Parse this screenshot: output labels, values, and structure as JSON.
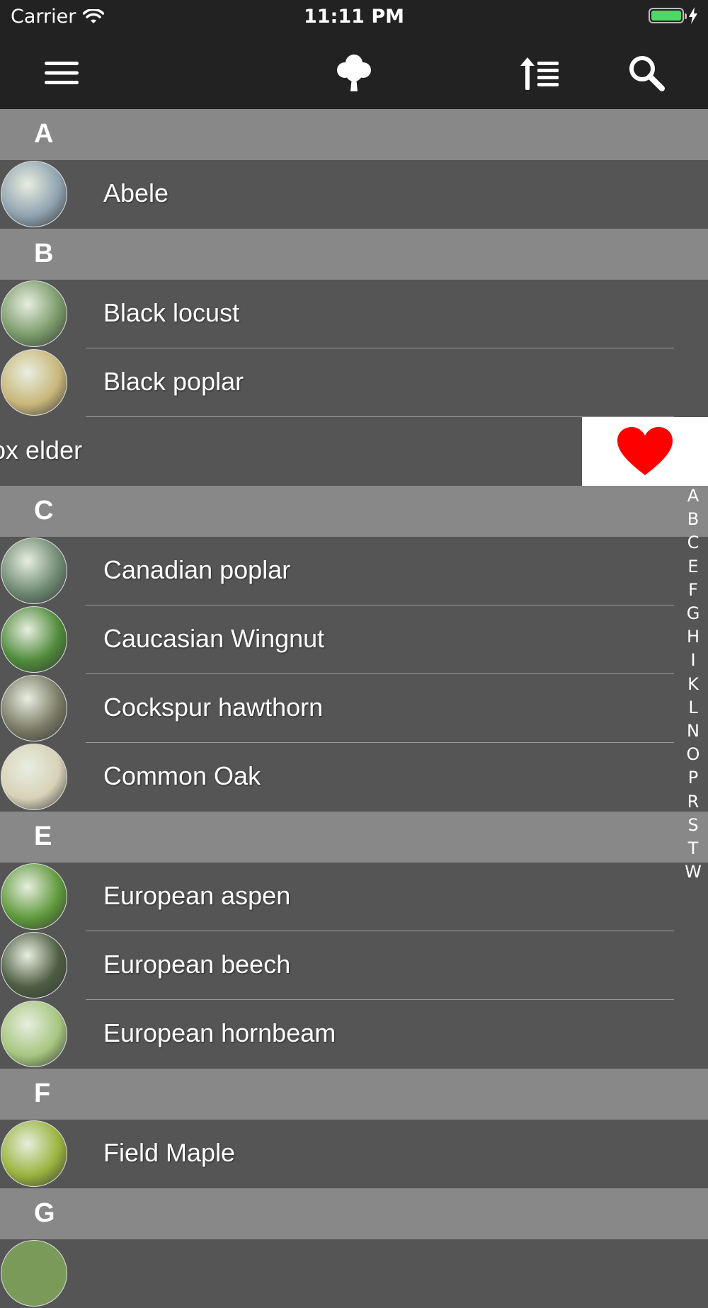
{
  "status_bar": {
    "carrier": "Carrier",
    "time": "11:11 PM"
  },
  "navbar": {
    "icons": [
      "menu-icon",
      "tree-icon",
      "sort-icon",
      "search-icon"
    ]
  },
  "sections": [
    {
      "letter": "A",
      "items": [
        {
          "name": "Abele",
          "thumb_color": "#8fa3b0"
        }
      ]
    },
    {
      "letter": "B",
      "items": [
        {
          "name": "Black locust",
          "thumb_color": "#7a9a6a"
        },
        {
          "name": "Black poplar",
          "thumb_color": "#c9b77a"
        },
        {
          "name": "ox elder",
          "thumb_color": "#555555"
        }
      ]
    },
    {
      "letter": "C",
      "items": [
        {
          "name": "Canadian poplar",
          "thumb_color": "#6e8a72"
        },
        {
          "name": "Caucasian Wingnut",
          "thumb_color": "#4f8a3a"
        },
        {
          "name": "Cockspur hawthorn",
          "thumb_color": "#7a7a66"
        },
        {
          "name": "Common Oak",
          "thumb_color": "#d8d2b8"
        }
      ]
    },
    {
      "letter": "E",
      "items": [
        {
          "name": "European aspen",
          "thumb_color": "#5f9a3c"
        },
        {
          "name": "European beech",
          "thumb_color": "#4e5e44"
        },
        {
          "name": "European hornbeam",
          "thumb_color": "#a7c680"
        }
      ]
    },
    {
      "letter": "F",
      "items": [
        {
          "name": "Field Maple",
          "thumb_color": "#9ab33e"
        }
      ]
    },
    {
      "letter": "G",
      "items": []
    }
  ],
  "swipe_action": {
    "icon": "heart-icon",
    "color": "#ff0000"
  },
  "section_index": [
    "A",
    "B",
    "C",
    "E",
    "F",
    "G",
    "H",
    "I",
    "K",
    "L",
    "N",
    "O",
    "P",
    "R",
    "S",
    "T",
    "W"
  ],
  "colors": {
    "bar_bg": "#222222",
    "row_bg": "#555555",
    "header_bg": "#888888"
  }
}
